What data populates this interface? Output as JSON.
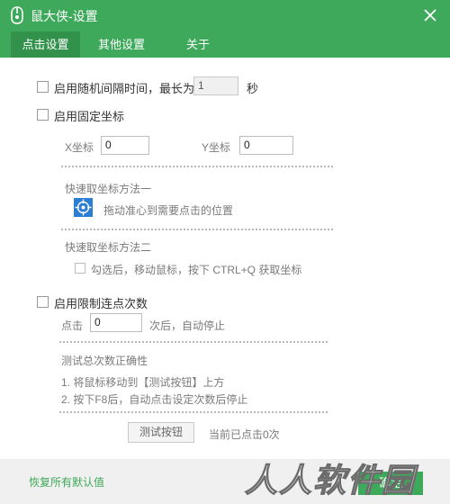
{
  "window": {
    "title": "鼠大侠-设置"
  },
  "tabs": [
    {
      "label": "点击设置",
      "active": true
    },
    {
      "label": "其他设置",
      "active": false
    },
    {
      "label": "关于",
      "active": false
    }
  ],
  "random_interval": {
    "label": "启用随机间隔时间，最长为",
    "value": "1",
    "unit": "秒",
    "checked": false
  },
  "fixed_coords": {
    "label": "启用固定坐标",
    "checked": false,
    "x_label": "X坐标",
    "x_value": "0",
    "y_label": "Y坐标",
    "y_value": "0",
    "method1_title": "快速取坐标方法一",
    "method1_text": "拖动准心到需要点击的位置",
    "method2_title": "快速取坐标方法二",
    "method2_text": "勾选后，移动鼠标，按下 CTRL+Q 获取坐标",
    "method2_checked": false
  },
  "limit_clicks": {
    "label": "启用限制连点次数",
    "checked": false,
    "prefix": "点击",
    "value": "0",
    "suffix": "次后，自动停止",
    "test_title": "测试总次数正确性",
    "step1": "1. 将鼠标移动到【测试按钮】上方",
    "step2": "2. 按下F8后，自动点击设定次数后停止",
    "test_button": "测试按钮",
    "counter_text": "当前已点击0次"
  },
  "footer": {
    "reset_label": "恢复所有默认值",
    "ok_label": "确定"
  },
  "watermark": {
    "text": "人人软件园"
  },
  "colors": {
    "accent": "#3ea95a",
    "accent_dark": "#32914b",
    "target_icon": "#2a7fd4"
  },
  "icons": {
    "app": "mouse-icon",
    "close": "close-icon",
    "target": "crosshair-target-icon"
  }
}
